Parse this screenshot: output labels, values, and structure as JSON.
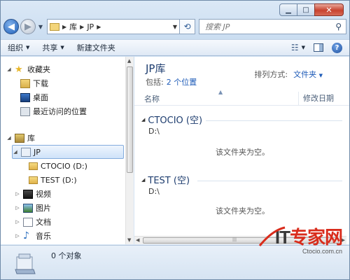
{
  "address": {
    "segments": [
      "库",
      "JP"
    ]
  },
  "search": {
    "placeholder": "搜索 JP"
  },
  "toolbar": {
    "organize": "组织",
    "share": "共享",
    "new_folder": "新建文件夹"
  },
  "nav": {
    "favorites": "收藏夹",
    "downloads": "下载",
    "desktop": "桌面",
    "recent": "最近访问的位置",
    "libraries": "库",
    "jp": "JP",
    "ctocio": "CTOCIO (D:)",
    "test": "TEST (D:)",
    "videos": "视频",
    "pictures": "图片",
    "documents": "文档",
    "music": "音乐"
  },
  "content": {
    "title": "JP库",
    "includes_label": "包括:",
    "includes_link": "2 个位置",
    "arrange_label": "排列方式:",
    "arrange_value": "文件夹",
    "col_name": "名称",
    "col_date": "修改日期",
    "groups": [
      {
        "name": "CTOCIO (空)",
        "path": "D:\\",
        "empty": "该文件夹为空。"
      },
      {
        "name": "TEST (空)",
        "path": "D:\\",
        "empty": "该文件夹为空。"
      }
    ]
  },
  "status": {
    "text": "0 个对象"
  },
  "watermark": {
    "it": "IT",
    "brand": "专家网",
    "url": "Ctocio.com.cn"
  },
  "colors": {
    "title_blue": "#1e3d6f",
    "link_blue": "#1e5bb8",
    "watermark_red": "#d92c1c"
  }
}
